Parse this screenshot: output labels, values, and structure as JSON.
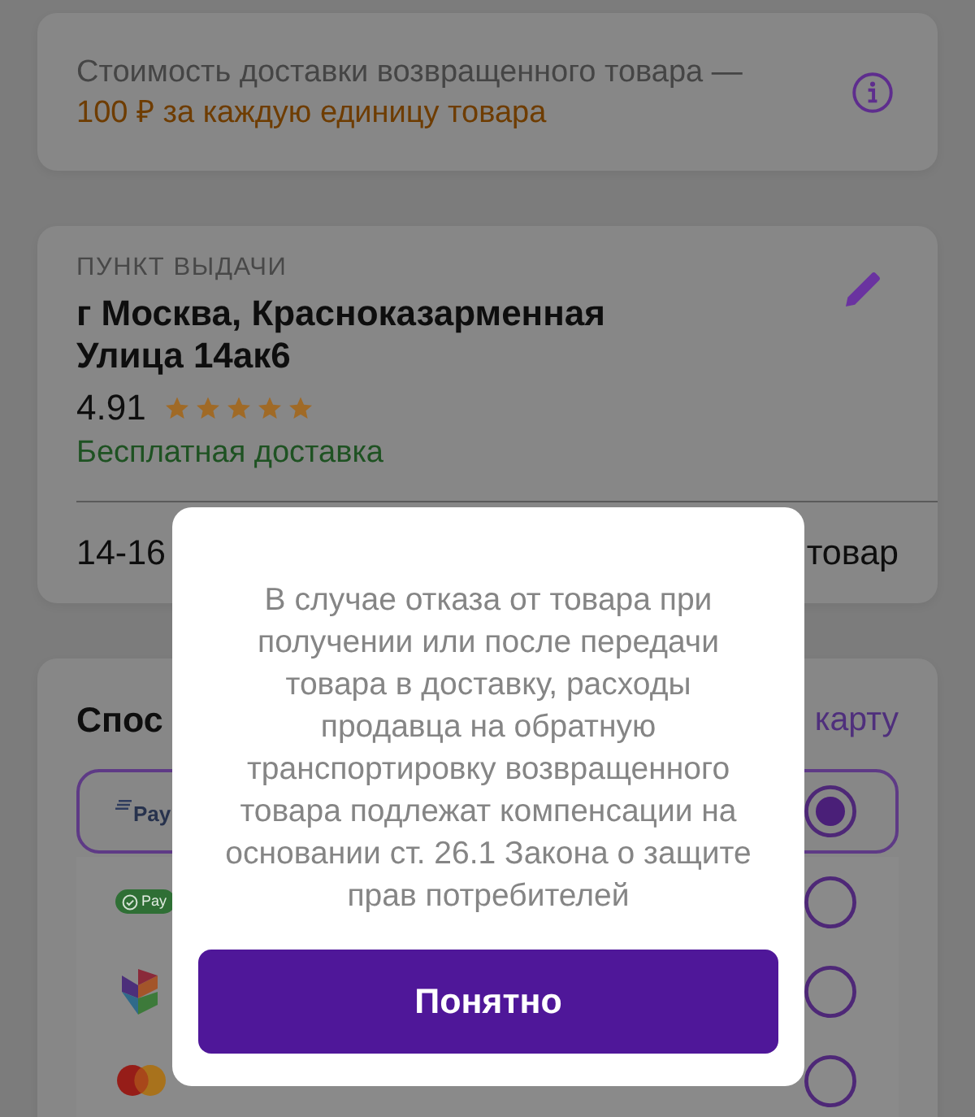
{
  "return_cost_notice": {
    "text": "Стоимость доставки возвращенного товара —",
    "price_text": "100 ₽ за каждую единицу товара"
  },
  "pickup_point": {
    "label": "ПУНКТ ВЫДАЧИ",
    "address": "г Москва, Красноказарменная Улица 14ак6",
    "rating": "4.91",
    "stars": 5,
    "delivery_note": "Бесплатная доставка",
    "summary_left": "14-16",
    "summary_right": "товар"
  },
  "payment": {
    "title": "Спос",
    "link": "карту",
    "methods": [
      {
        "kind": "wallet",
        "logo_text": "Pay",
        "selected": true
      },
      {
        "kind": "green_pay",
        "logo_text": "Pay",
        "selected": false
      },
      {
        "kind": "fast_payment",
        "selected": false
      },
      {
        "kind": "card",
        "selected": false
      }
    ]
  },
  "dialog": {
    "message": "В случае отказа от товара при получении или после передачи товара в доставку, расходы продавца на обратную транспортировку возвращенного товара подлежат компенсации на основании ст. 26.1 Закона о защите прав потребителей",
    "button": "Понятно"
  }
}
